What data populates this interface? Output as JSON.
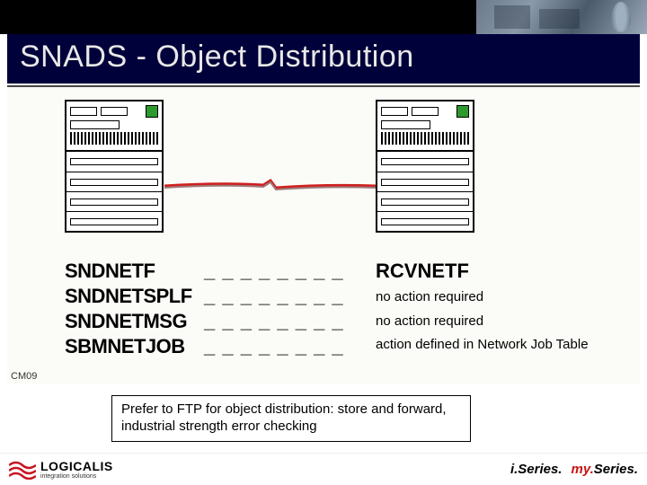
{
  "header": {
    "skyline_alt": "city-skyline-photo"
  },
  "title": "SNADS - Object Distribution",
  "diagram": {
    "left_server_alt": "as400-server-left",
    "right_server_alt": "as400-server-right",
    "cable_alt": "connection-cable",
    "corner_tag": "CM09"
  },
  "left_commands": [
    {
      "label": "SNDNETF",
      "trail": "_ _ _ _ _ _ _ _"
    },
    {
      "label": "SNDNETSPLF",
      "trail": "_ _ _ _ _ _ _ _"
    },
    {
      "label": "SNDNETMSG",
      "trail": "_ _ _ _ _ _ _ _"
    },
    {
      "label": "SBMNETJOB",
      "trail": "_ _ _ _ _ _ _ _"
    }
  ],
  "right_items": [
    {
      "label": "RCVNETF",
      "note": ""
    },
    {
      "label": "",
      "note": "no action required"
    },
    {
      "label": "",
      "note": "no action required"
    },
    {
      "label": "",
      "note": "action defined in Network Job Table"
    }
  ],
  "callout": "Prefer to FTP for object distribution: store and forward, industrial strength error checking",
  "footer": {
    "logicalis_name": "LOGICALIS",
    "logicalis_tag": "integration solutions",
    "iseries": "i.Series.",
    "myseries_prefix": "my.",
    "myseries_suffix": "Series."
  }
}
